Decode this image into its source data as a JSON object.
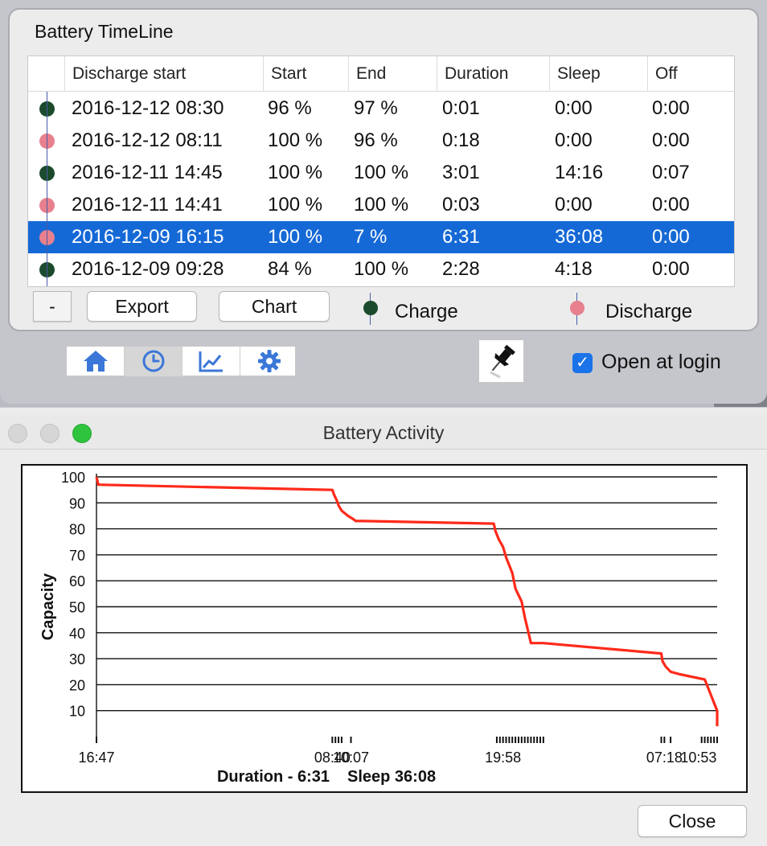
{
  "timeline": {
    "title": "Battery TimeLine",
    "columns": [
      "Discharge start",
      "Start",
      "End",
      "Duration",
      "Sleep",
      "Off"
    ],
    "rows": [
      {
        "type": "charge",
        "start_time": "2016-12-12 08:30",
        "start": "96 %",
        "end": "97 %",
        "duration": "0:01",
        "sleep": "0:00",
        "off": "0:00",
        "selected": false
      },
      {
        "type": "discharge",
        "start_time": "2016-12-12 08:11",
        "start": "100 %",
        "end": "96 %",
        "duration": "0:18",
        "sleep": "0:00",
        "off": "0:00",
        "selected": false
      },
      {
        "type": "charge",
        "start_time": "2016-12-11 14:45",
        "start": "100 %",
        "end": "100 %",
        "duration": "3:01",
        "sleep": "14:16",
        "off": "0:07",
        "selected": false
      },
      {
        "type": "discharge",
        "start_time": "2016-12-11 14:41",
        "start": "100 %",
        "end": "100 %",
        "duration": "0:03",
        "sleep": "0:00",
        "off": "0:00",
        "selected": false
      },
      {
        "type": "discharge",
        "start_time": "2016-12-09 16:15",
        "start": "100 %",
        "end": "7 %",
        "duration": "6:31",
        "sleep": "36:08",
        "off": "0:00",
        "selected": true
      },
      {
        "type": "charge",
        "start_time": "2016-12-09 09:28",
        "start": "84 %",
        "end": "100 %",
        "duration": "2:28",
        "sleep": "4:18",
        "off": "0:00",
        "selected": false
      }
    ],
    "buttons": {
      "minus": "-",
      "export": "Export",
      "chart": "Chart"
    },
    "legend": {
      "charge": "Charge",
      "discharge": "Discharge"
    }
  },
  "toolbar": {
    "items": [
      {
        "icon": "home-icon",
        "active": false
      },
      {
        "icon": "clock-icon",
        "active": true
      },
      {
        "icon": "chart-icon",
        "active": false
      },
      {
        "icon": "gear-icon",
        "active": false
      }
    ]
  },
  "pin_icon": "pushpin-icon",
  "open_at_login": {
    "label": "Open at login",
    "checked": true
  },
  "activity_window": {
    "title": "Battery Activity",
    "close_label": "Close"
  },
  "colors": {
    "charge": "#1b4a2c",
    "discharge": "#e8808d",
    "selection": "#1569d6",
    "line": "#ff2a1a",
    "accent": "#1a73e8"
  },
  "chart_data": {
    "type": "line",
    "ylabel": "Capacity",
    "yticks": [
      10,
      20,
      30,
      40,
      50,
      60,
      70,
      80,
      90,
      100
    ],
    "ylim": [
      0,
      100
    ],
    "grid": true,
    "xticks": [
      "16:47",
      "08:40",
      "10:07",
      "19:58",
      "07:18",
      "10:53"
    ],
    "xtick_positions": [
      0,
      0.38,
      0.41,
      0.655,
      0.915,
      0.97
    ],
    "footer": {
      "duration": "Duration - 6:31",
      "sleep": "Sleep 36:08"
    },
    "series": [
      {
        "x": [
          0,
          0.003,
          0.38,
          0.383,
          0.387,
          0.39,
          0.395,
          0.405,
          0.412,
          0.418,
          0.43,
          0.64,
          0.643,
          0.648,
          0.655,
          0.66,
          0.67,
          0.675,
          0.685,
          0.69,
          0.7,
          0.72,
          0.91,
          0.912,
          0.917,
          0.925,
          0.94,
          0.98,
          0.985,
          0.99,
          0.995,
          1.0,
          1.0
        ],
        "y": [
          100,
          97,
          95,
          93,
          91,
          89,
          87,
          85,
          84,
          83,
          83,
          82,
          79,
          76,
          73,
          69,
          63,
          57,
          52,
          46,
          36,
          36,
          32,
          29,
          27,
          25,
          24,
          22,
          19,
          16,
          13,
          10,
          4
        ]
      }
    ]
  }
}
